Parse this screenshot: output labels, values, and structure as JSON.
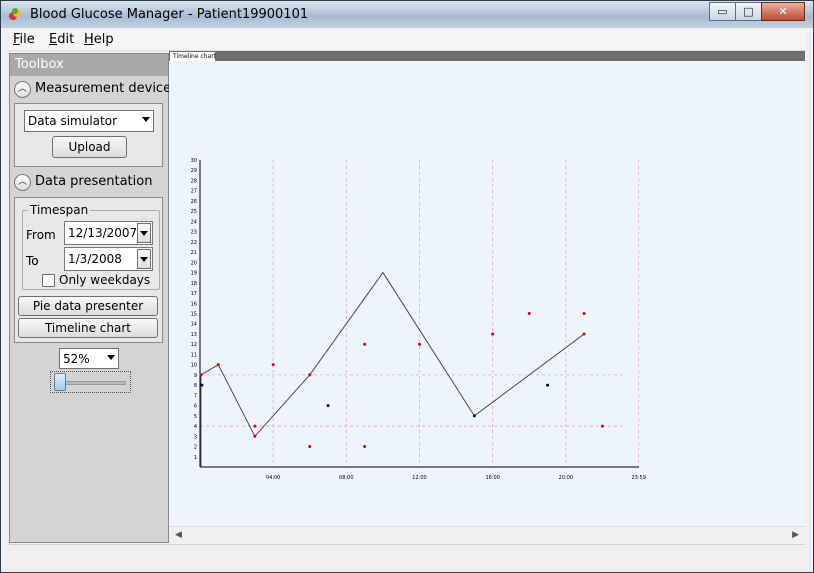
{
  "window": {
    "title": "Blood Glucose Manager - Patient19900101"
  },
  "caption_buttons": {
    "minimize": "▭",
    "maximize": "□",
    "close": "✕"
  },
  "menu": [
    {
      "label": "File",
      "accel": "F",
      "rest": "ile"
    },
    {
      "label": "Edit",
      "accel": "E",
      "rest": "dit"
    },
    {
      "label": "Help",
      "accel": "H",
      "rest": "elp"
    }
  ],
  "toolbox": {
    "title": "Toolbox",
    "devices": {
      "header": "Measurement devices",
      "device_select": "Data simulator",
      "upload_label": "Upload"
    },
    "presentation": {
      "header": "Data presentation",
      "timespan_legend": "Timespan",
      "from_label": "From",
      "from_value": "12/13/2007",
      "to_label": "To",
      "to_value": "1/3/2008",
      "weekdays_label": "Only weekdays",
      "pie_label": "Pie data presenter",
      "timeline_label": "Timeline chart"
    },
    "zoom": {
      "value": "52%",
      "slider_fraction": 0.0
    }
  },
  "tab": {
    "label": "Timeline chart"
  },
  "chart_data": {
    "type": "line",
    "title": "",
    "xlabel": "",
    "ylabel": "",
    "xlim": [
      0,
      24
    ],
    "ylim": [
      0,
      30
    ],
    "x_ticks": [
      "04:00",
      "08:00",
      "12:00",
      "16:00",
      "20:00",
      "23:59"
    ],
    "x_tick_values": [
      4,
      8,
      12,
      16,
      20,
      23.983
    ],
    "y_ticks": [
      1,
      2,
      3,
      4,
      5,
      6,
      7,
      8,
      9,
      10,
      11,
      12,
      13,
      14,
      15,
      16,
      17,
      18,
      19,
      20,
      21,
      22,
      23,
      24,
      25,
      26,
      27,
      28,
      29,
      30
    ],
    "grid": "dashed vertical at x ticks; dashed horizontal at 4 and 9",
    "line": {
      "x": [
        0.05,
        0.05,
        1.0,
        3.0,
        6.0,
        10.0,
        15.0,
        21.0
      ],
      "y": [
        0,
        9,
        10,
        3,
        9,
        19,
        5,
        13
      ]
    },
    "red_points": {
      "x": [
        0.05,
        1.0,
        3.0,
        3.0,
        4.0,
        6.0,
        6.0,
        9.0,
        9.0,
        12.0,
        16.0,
        18.0,
        21.0,
        21.0,
        22.0
      ],
      "y": [
        9,
        10,
        3,
        4,
        10,
        9,
        2,
        12,
        2,
        12,
        13,
        15,
        15,
        13,
        4
      ]
    },
    "blue_points": {
      "x": [
        0.1,
        7.0,
        15.0,
        19.0
      ],
      "y": [
        8,
        6,
        5,
        8
      ]
    }
  },
  "colors": {
    "line": "#4a4a4a",
    "red_point": "#e00000",
    "blue_point": "#00008b",
    "grid": "#e6a0c8",
    "axis": "#000000"
  }
}
